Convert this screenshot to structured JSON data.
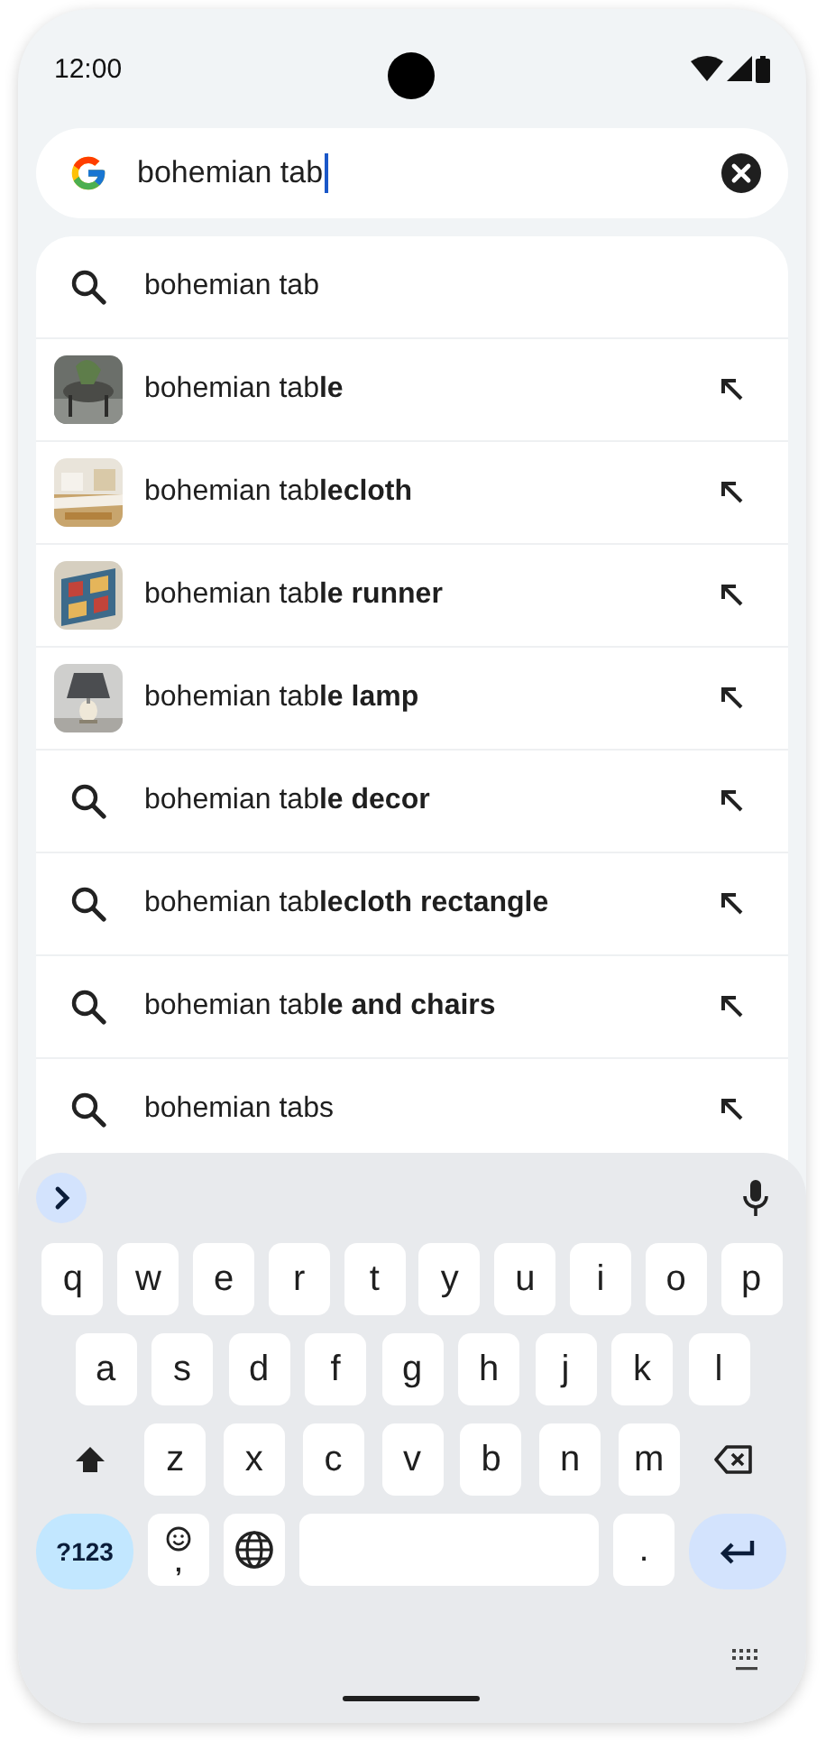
{
  "status_bar": {
    "time": "12:00"
  },
  "search": {
    "value": "bohemian tab"
  },
  "suggestions": [
    {
      "kind": "search",
      "text": "bohemian tab",
      "insert_arrow": false
    },
    {
      "text": "bohemian tab**le**",
      "insert_arrow": true
    },
    {
      "text": "bohemian tab**lecloth**",
      "insert_arrow": true
    },
    {
      "text": "bohemian tab**le runner**",
      "insert_arrow": true
    },
    {
      "text": "bohemian tab**le lamp**",
      "insert_arrow": true
    },
    {
      "kind": "search",
      "text": "bohemian tab**le decor**",
      "insert_arrow": true
    },
    {
      "kind": "search",
      "text": "bohemian tab**lecloth rectangle**",
      "insert_arrow": true
    },
    {
      "kind": "search",
      "text": "bohemian tab**le and chairs**",
      "insert_arrow": true
    },
    {
      "kind": "search",
      "text": "bohemian tabs",
      "insert_arrow": true
    }
  ],
  "keyboard": {
    "rows": [
      [
        "q",
        "w",
        "e",
        "r",
        "t",
        "y",
        "u",
        "i",
        "o",
        "p"
      ],
      [
        "a",
        "s",
        "d",
        "f",
        "g",
        "h",
        "j",
        "k",
        "l"
      ],
      [
        "z",
        "x",
        "c",
        "v",
        "b",
        "n",
        "m"
      ]
    ],
    "symbols_key": "?123",
    "comma_key": ",",
    "period_key": "."
  }
}
